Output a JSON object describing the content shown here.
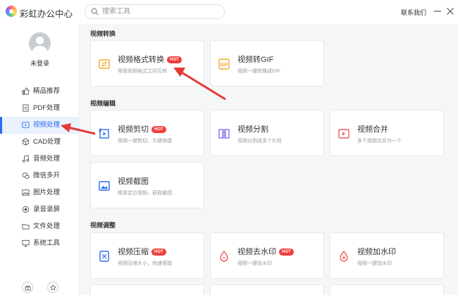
{
  "app": {
    "title": "彩虹办公中心",
    "contact": "联系我们"
  },
  "search": {
    "placeholder": "搜索工具"
  },
  "user": {
    "login_label": "未登录"
  },
  "sidebar": {
    "items": [
      {
        "label": "精品推荐",
        "icon": "thumbs-up-icon"
      },
      {
        "label": "PDF处理",
        "icon": "pdf-icon"
      },
      {
        "label": "视频处理",
        "icon": "video-icon",
        "active": true
      },
      {
        "label": "CAD处理",
        "icon": "cad-icon"
      },
      {
        "label": "音频处理",
        "icon": "music-icon"
      },
      {
        "label": "微信多开",
        "icon": "chat-icon"
      },
      {
        "label": "图片处理",
        "icon": "image-icon"
      },
      {
        "label": "录音录屏",
        "icon": "record-icon"
      },
      {
        "label": "文件处理",
        "icon": "folder-icon"
      },
      {
        "label": "系统工具",
        "icon": "system-icon"
      }
    ]
  },
  "badge": {
    "hot": "HOT"
  },
  "sections": [
    {
      "title": "视频转换",
      "cards": [
        {
          "title": "视频格式转换",
          "desc": "常规视频格式之间互转",
          "hot": true
        },
        {
          "title": "视频转GIF",
          "desc": "视频一键转换成GIF",
          "hot": false
        }
      ]
    },
    {
      "title": "视频编辑",
      "cards": [
        {
          "title": "视频剪切",
          "desc": "视频一键剪切，方便快捷",
          "hot": true
        },
        {
          "title": "视频分割",
          "desc": "视频分割成多个片段",
          "hot": false
        },
        {
          "title": "视频合并",
          "desc": "多个视频合并为一个",
          "hot": false
        },
        {
          "title": "视频截图",
          "desc": "精准定位视频，获取截图",
          "hot": false
        }
      ]
    },
    {
      "title": "视频调整",
      "cards": [
        {
          "title": "视频压缩",
          "desc": "视频压缩大小，快速便捷",
          "hot": true
        },
        {
          "title": "视频去水印",
          "desc": "视频一键去水印",
          "hot": true
        },
        {
          "title": "视频加水印",
          "desc": "视频一键加水印",
          "hot": false
        }
      ]
    }
  ],
  "colors": {
    "accent": "#2b6bf3",
    "hot": "#f23c3c",
    "annotation_arrow": "#e53935",
    "icon_orange": "#f7a531",
    "icon_purple": "#8b6cf0",
    "icon_red": "#ef5b5b"
  }
}
